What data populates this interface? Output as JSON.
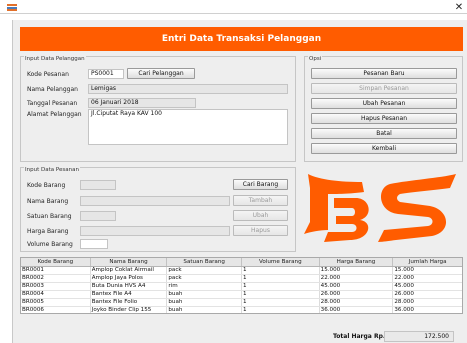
{
  "window": {
    "icon": "app-icon",
    "close_glyph": "✕"
  },
  "header": {
    "title": "Entri Data Transaksi Pelanggan",
    "color": "#ff5c00"
  },
  "pelanggan_panel": {
    "title": "Input Data Pelanggan",
    "kode_label": "Kode Pesanan",
    "kode_value": "PS0001",
    "cari_button": "Cari Pelanggan",
    "nama_label": "Nama Pelanggan",
    "nama_value": "Lemigas",
    "tanggal_label": "Tanggal Pesanan",
    "tanggal_value": "06 Januari 2018",
    "alamat_label": "Alamat Pelanggan",
    "alamat_value": "Jl.Ciputat Raya KAV 100"
  },
  "opsi_panel": {
    "title": "Opsi",
    "buttons": [
      {
        "label": "Pesanan Baru",
        "enabled": true
      },
      {
        "label": "Simpan Pesanan",
        "enabled": false
      },
      {
        "label": "Ubah Pesanan",
        "enabled": true
      },
      {
        "label": "Hapus Pesanan",
        "enabled": true
      },
      {
        "label": "Batal",
        "enabled": true
      },
      {
        "label": "Kembali",
        "enabled": true
      }
    ]
  },
  "pesanan_panel": {
    "title": "Input Data Pesanan",
    "kode_label": "Kode Barang",
    "nama_label": "Nama Barang",
    "satuan_label": "Satuan Barang",
    "harga_label": "Harga Barang",
    "volume_label": "Volume Barang",
    "cari_button": "Cari Barang",
    "tambah_button": "Tambah",
    "ubah_button": "Ubah",
    "hapus_button": "Hapus"
  },
  "logo": {
    "icon": "bs-logo-icon",
    "color": "#ff5c00"
  },
  "table": {
    "headers": [
      "Kode Barang",
      "Nama Barang",
      "Satuan Barang",
      "Volume Barang",
      "Harga Barang",
      "Jumlah Harga"
    ],
    "rows": [
      [
        "BR0001",
        "Amplop Coklat Airmail",
        "pack",
        "1",
        "15.000",
        "15.000"
      ],
      [
        "BR0002",
        "Amplop Jaya Polos",
        "pack",
        "1",
        "22.000",
        "22.000"
      ],
      [
        "BR0003",
        "Buta Dunia HVS A4",
        "rim",
        "1",
        "45.000",
        "45.000"
      ],
      [
        "BR0004",
        "Bantex File A4",
        "buah",
        "1",
        "26.000",
        "26.000"
      ],
      [
        "BR0005",
        "Bantex File Folio",
        "buah",
        "1",
        "28.000",
        "28.000"
      ],
      [
        "BR0006",
        "Joyko Binder Clip 155",
        "buah",
        "1",
        "36.000",
        "36.000"
      ]
    ]
  },
  "footer": {
    "total_label": "Total Harga  Rp.",
    "total_value": "172.500"
  }
}
